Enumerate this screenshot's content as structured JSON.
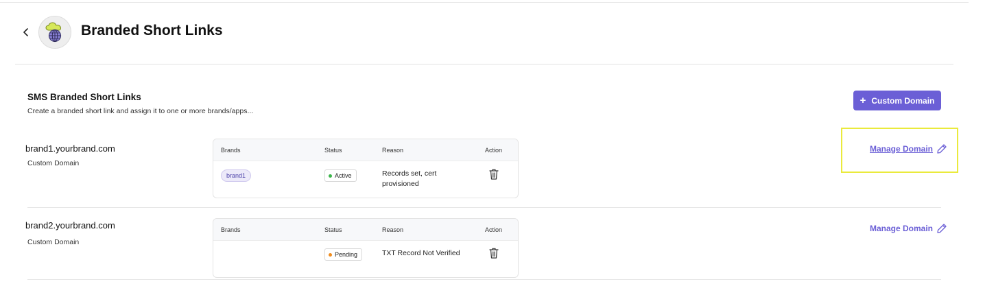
{
  "header": {
    "title": "Branded Short Links",
    "back_icon": "chevron-left-icon",
    "logo_icon": "cloud-globe-icon"
  },
  "section": {
    "title": "SMS Branded Short Links",
    "subtitle": "Create a branded short link and assign it to one or more brands/apps...",
    "add_button_icon": "+",
    "add_button_label": "Custom Domain"
  },
  "table_headers": {
    "brands": "Brands",
    "status": "Status",
    "reason": "Reason",
    "action": "Action"
  },
  "domains": [
    {
      "name": "brand1.yourbrand.com",
      "type": "Custom Domain",
      "brands": [
        "brand1"
      ],
      "status": "Active",
      "status_color": "#3bb54a",
      "reason": "Records set, cert provisioned",
      "action_icon": "trash-icon",
      "manage_label": "Manage Domain",
      "manage_icon": "pencil-icon"
    },
    {
      "name": "brand2.yourbrand.com",
      "type": "Custom Domain",
      "brands": [],
      "status": "Pending",
      "status_color": "#f08c1e",
      "reason": "TXT Record Not Verified",
      "action_icon": "trash-icon",
      "manage_label": "Manage Domain",
      "manage_icon": "pencil-icon"
    }
  ],
  "colors": {
    "accent": "#6b5fd6",
    "highlight": "#eaea3c"
  }
}
